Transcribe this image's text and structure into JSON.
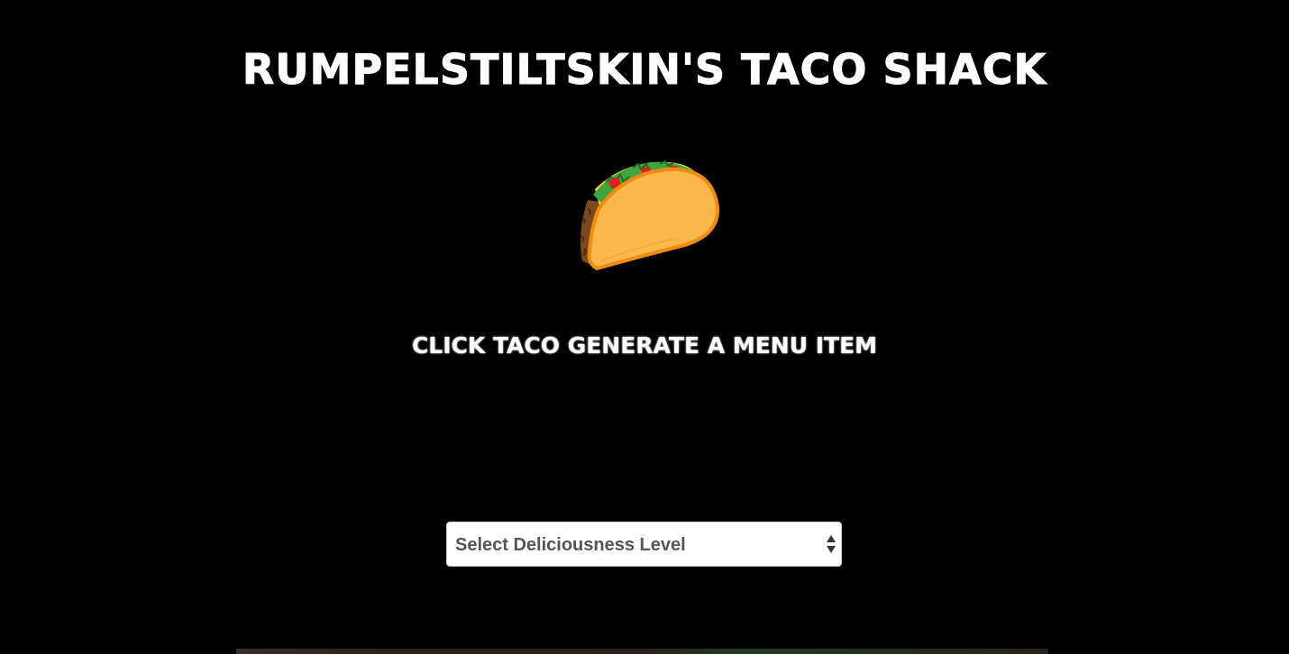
{
  "header": {
    "title": "Rumpelstiltskin's Taco Shack"
  },
  "main": {
    "taco_icon": "taco-icon",
    "instruction": "Click Taco Generate a menu item",
    "select": {
      "selected_value": "Select Deliciousness Level"
    }
  },
  "colors": {
    "background": "#000000",
    "text": "#ffffff",
    "taco_shell": "#FCB74E",
    "taco_shell_outline": "#F28C0F",
    "beef": "#7A4A1E",
    "lettuce": "#2E8B2E",
    "tomato": "#E02020"
  }
}
